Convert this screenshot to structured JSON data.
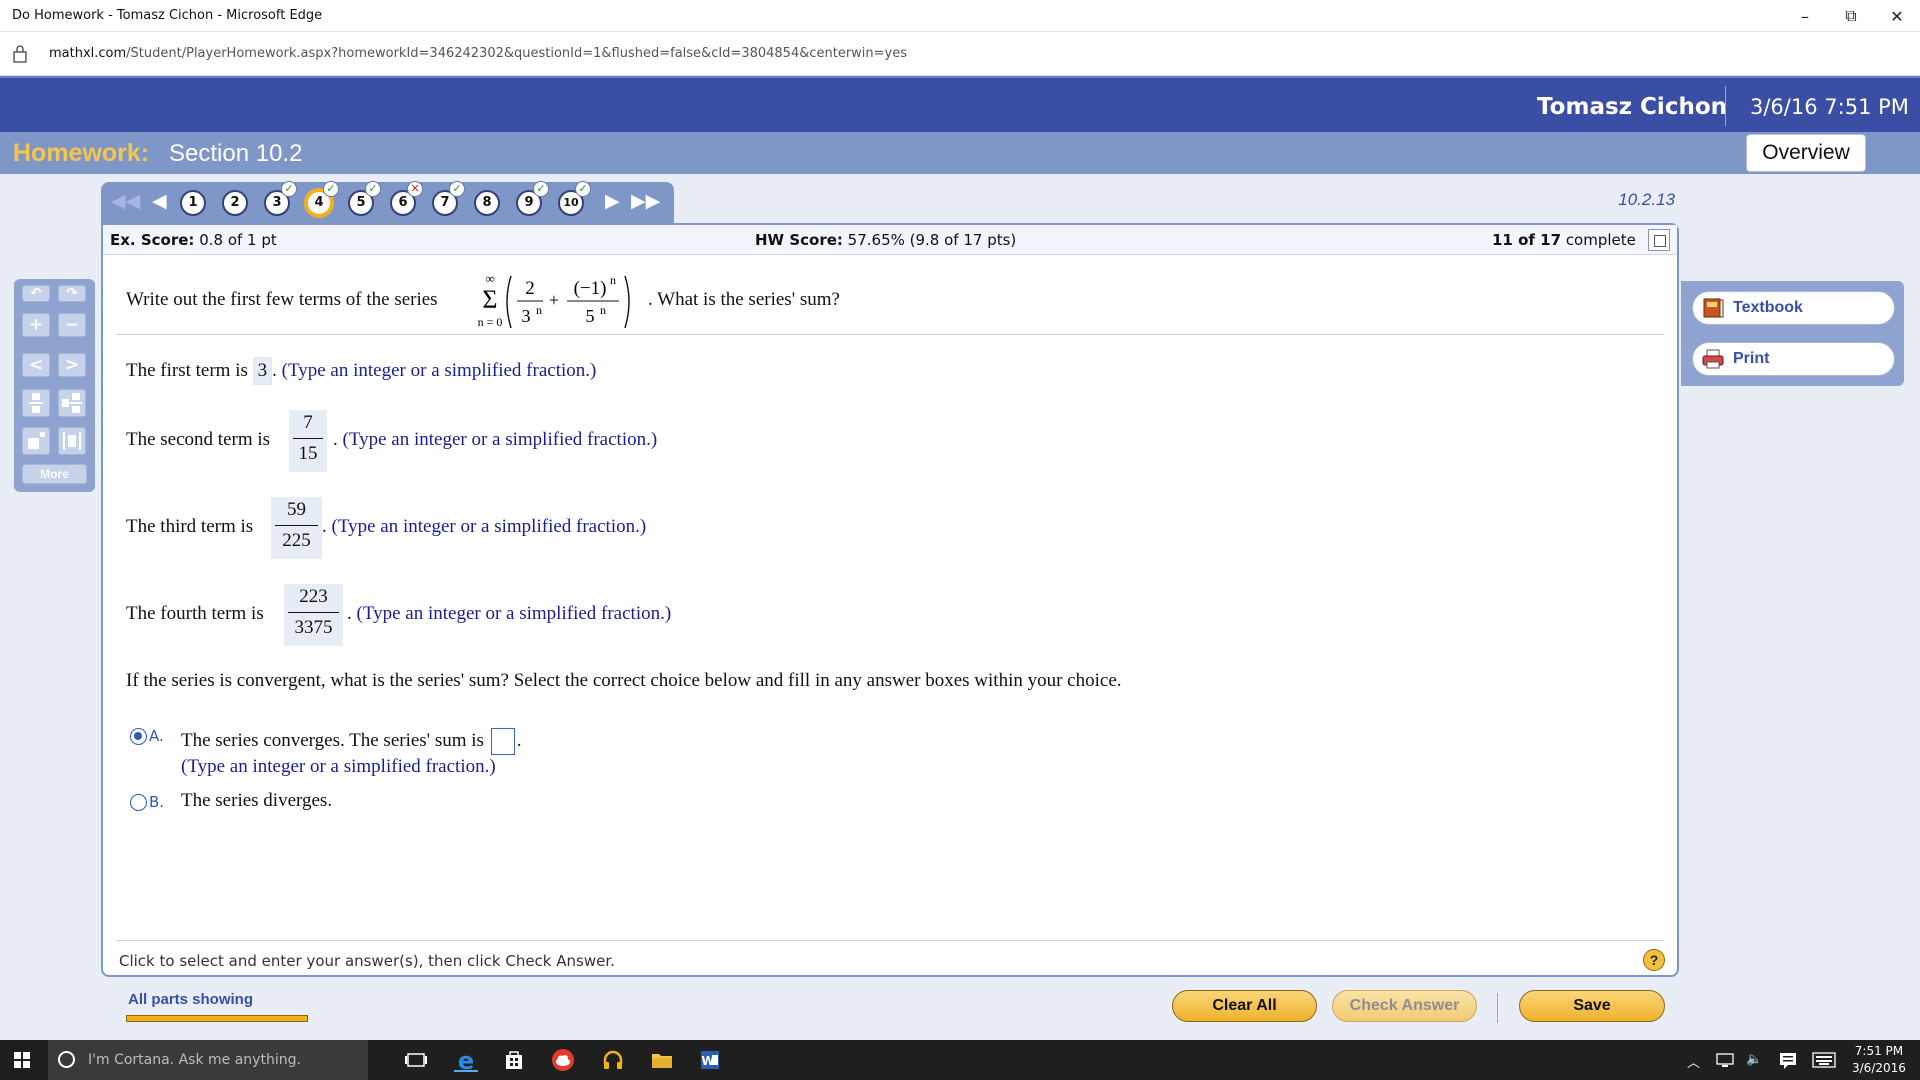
{
  "window": {
    "title": "Do Homework - Tomasz Cichon - Microsoft Edge",
    "controls": {
      "minimize": "–",
      "restore": "⧉",
      "close": "✕"
    }
  },
  "address": {
    "domain": "mathxl.com",
    "path": "/Student/PlayerHomework.aspx?homeworkId=346242302&questionId=1&flushed=false&cId=3804854&centerwin=yes"
  },
  "header": {
    "user": "Tomasz Cichon",
    "datetime": "3/6/16 7:51 PM",
    "homework_label": "Homework:",
    "section": "Section 10.2",
    "overview": "Overview"
  },
  "question_nav": {
    "first": "◀◀",
    "prev": "◀",
    "next": "▶",
    "last": "▶▶",
    "question_id": "10.2.13",
    "questions": [
      {
        "n": "1",
        "mark": ""
      },
      {
        "n": "2",
        "mark": ""
      },
      {
        "n": "3",
        "mark": "✓"
      },
      {
        "n": "4",
        "mark": "✓"
      },
      {
        "n": "5",
        "mark": "✓"
      },
      {
        "n": "6",
        "mark": "✕"
      },
      {
        "n": "7",
        "mark": "✓"
      },
      {
        "n": "8",
        "mark": ""
      },
      {
        "n": "9",
        "mark": "✓"
      },
      {
        "n": "10",
        "mark": "✓"
      }
    ]
  },
  "scores": {
    "ex_label": "Ex. Score:",
    "ex_value": "0.8 of 1 pt",
    "hw_label": "HW Score:",
    "hw_value": "57.65% (9.8 of 17 pts)",
    "complete_count": "11 of 17",
    "complete_word": "complete"
  },
  "question": {
    "stem_before": "Write out the first few terms of the series",
    "stem_after": ". What is the series' sum?",
    "sum_upper": "∞",
    "sum_sigma": "Σ",
    "sum_lower": "n = 0",
    "num1": "2",
    "den1": "3",
    "plus": "+",
    "num2": "(−1)",
    "den2": "5",
    "exp": "n"
  },
  "terms": {
    "first_label": "The first term is",
    "first_value": "3",
    "second_label": "The second term is",
    "second_num": "7",
    "second_den": "15",
    "third_label": "The third term is",
    "third_num": "59",
    "third_den": "225",
    "fourth_label": "The fourth term is",
    "fourth_num": "223",
    "fourth_den": "3375",
    "hint": "(Type an integer or a simplified fraction.)",
    "period": "."
  },
  "prompt": "If the series is convergent, what is the series' sum? Select the correct choice below and fill in any answer boxes within your choice.",
  "choices": {
    "a_letter": "A.",
    "a_text": "The series converges. The series' sum is",
    "a_hint": "(Type an integer or a simplified fraction.)",
    "b_letter": "B.",
    "b_text": "The series diverges."
  },
  "footer": {
    "hint": "Click to select and enter your answer(s), then click Check Answer.",
    "help": "?",
    "all_parts": "All parts showing",
    "clear_all": "Clear All",
    "check_answer": "Check Answer",
    "save": "Save"
  },
  "tools": {
    "undo": "↶",
    "redo": "↷",
    "plus": "+",
    "minus": "−",
    "less": "<",
    "greater": ">",
    "more": "More"
  },
  "side": {
    "textbook": "Textbook",
    "print": "Print"
  },
  "taskbar": {
    "cortana": "I'm Cortana. Ask me anything.",
    "time": "7:51 PM",
    "date": "3/6/2016"
  },
  "colors": {
    "header_blue": "#3b4ea6",
    "bar_blue": "#7f97c7",
    "homework_gold": "#f5c64b",
    "answer_blue": "#1a1f8f"
  }
}
